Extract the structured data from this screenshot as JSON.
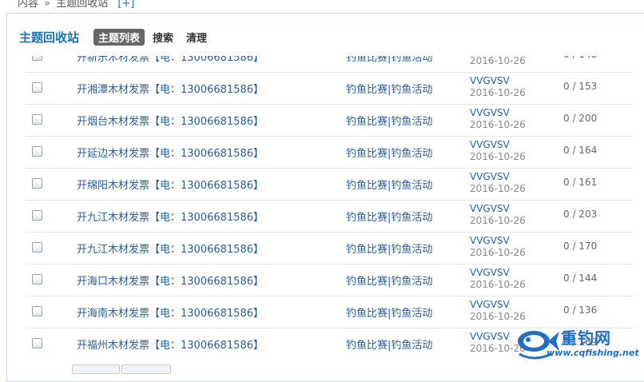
{
  "breadcrumb": {
    "item1": "内容",
    "separator": "»",
    "item2": "主题回收站",
    "plus": "[+]"
  },
  "toolbar": {
    "title": "主题回收站",
    "tabs": [
      {
        "label": "主题列表"
      },
      {
        "label": "搜索"
      },
      {
        "label": "清理"
      }
    ]
  },
  "rows": [
    {
      "subject": "开新乐木材发票【电：13006681586】",
      "forum": "钓鱼比赛|钓鱼活动",
      "author": "VVGVSV",
      "date": "2016-10-26",
      "count": "0 / 148"
    },
    {
      "subject": "开湘潭木材发票【电：13006681586】",
      "forum": "钓鱼比赛|钓鱼活动",
      "author": "VVGVSV",
      "date": "2016-10-26",
      "count": "0 / 153"
    },
    {
      "subject": "开烟台木材发票【电：13006681586】",
      "forum": "钓鱼比赛|钓鱼活动",
      "author": "VVGVSV",
      "date": "2016-10-26",
      "count": "0 / 200"
    },
    {
      "subject": "开延边木材发票【电：13006681586】",
      "forum": "钓鱼比赛|钓鱼活动",
      "author": "VVGVSV",
      "date": "2016-10-26",
      "count": "0 / 164"
    },
    {
      "subject": "开绵阳木材发票【电：13006681586】",
      "forum": "钓鱼比赛|钓鱼活动",
      "author": "VVGVSV",
      "date": "2016-10-26",
      "count": "0 / 161"
    },
    {
      "subject": "开九江木材发票【电：13006681586】",
      "forum": "钓鱼比赛|钓鱼活动",
      "author": "VVGVSV",
      "date": "2016-10-26",
      "count": "0 / 203"
    },
    {
      "subject": "开九江木材发票【电：13006681586】",
      "forum": "钓鱼比赛|钓鱼活动",
      "author": "VVGVSV",
      "date": "2016-10-26",
      "count": "0 / 170"
    },
    {
      "subject": "开海口木材发票【电：13006681586】",
      "forum": "钓鱼比赛|钓鱼活动",
      "author": "VVGVSV",
      "date": "2016-10-26",
      "count": "0 / 144"
    },
    {
      "subject": "开海南木材发票【电：13006681586】",
      "forum": "钓鱼比赛|钓鱼活动",
      "author": "VVGVSV",
      "date": "2016-10-26",
      "count": "0 / 136"
    },
    {
      "subject": "开福州木材发票【电：13006681586】",
      "forum": "钓鱼比赛|钓鱼活动",
      "author": "VVGVSV",
      "date": "2016-10-26",
      "count": "0 / 169"
    }
  ],
  "watermark": {
    "title": "重钓网",
    "url": "www.cqfishing.net"
  },
  "colors": {
    "link": "#2a5e9a",
    "accent": "#1a73b5",
    "active_tab": "#666666"
  }
}
